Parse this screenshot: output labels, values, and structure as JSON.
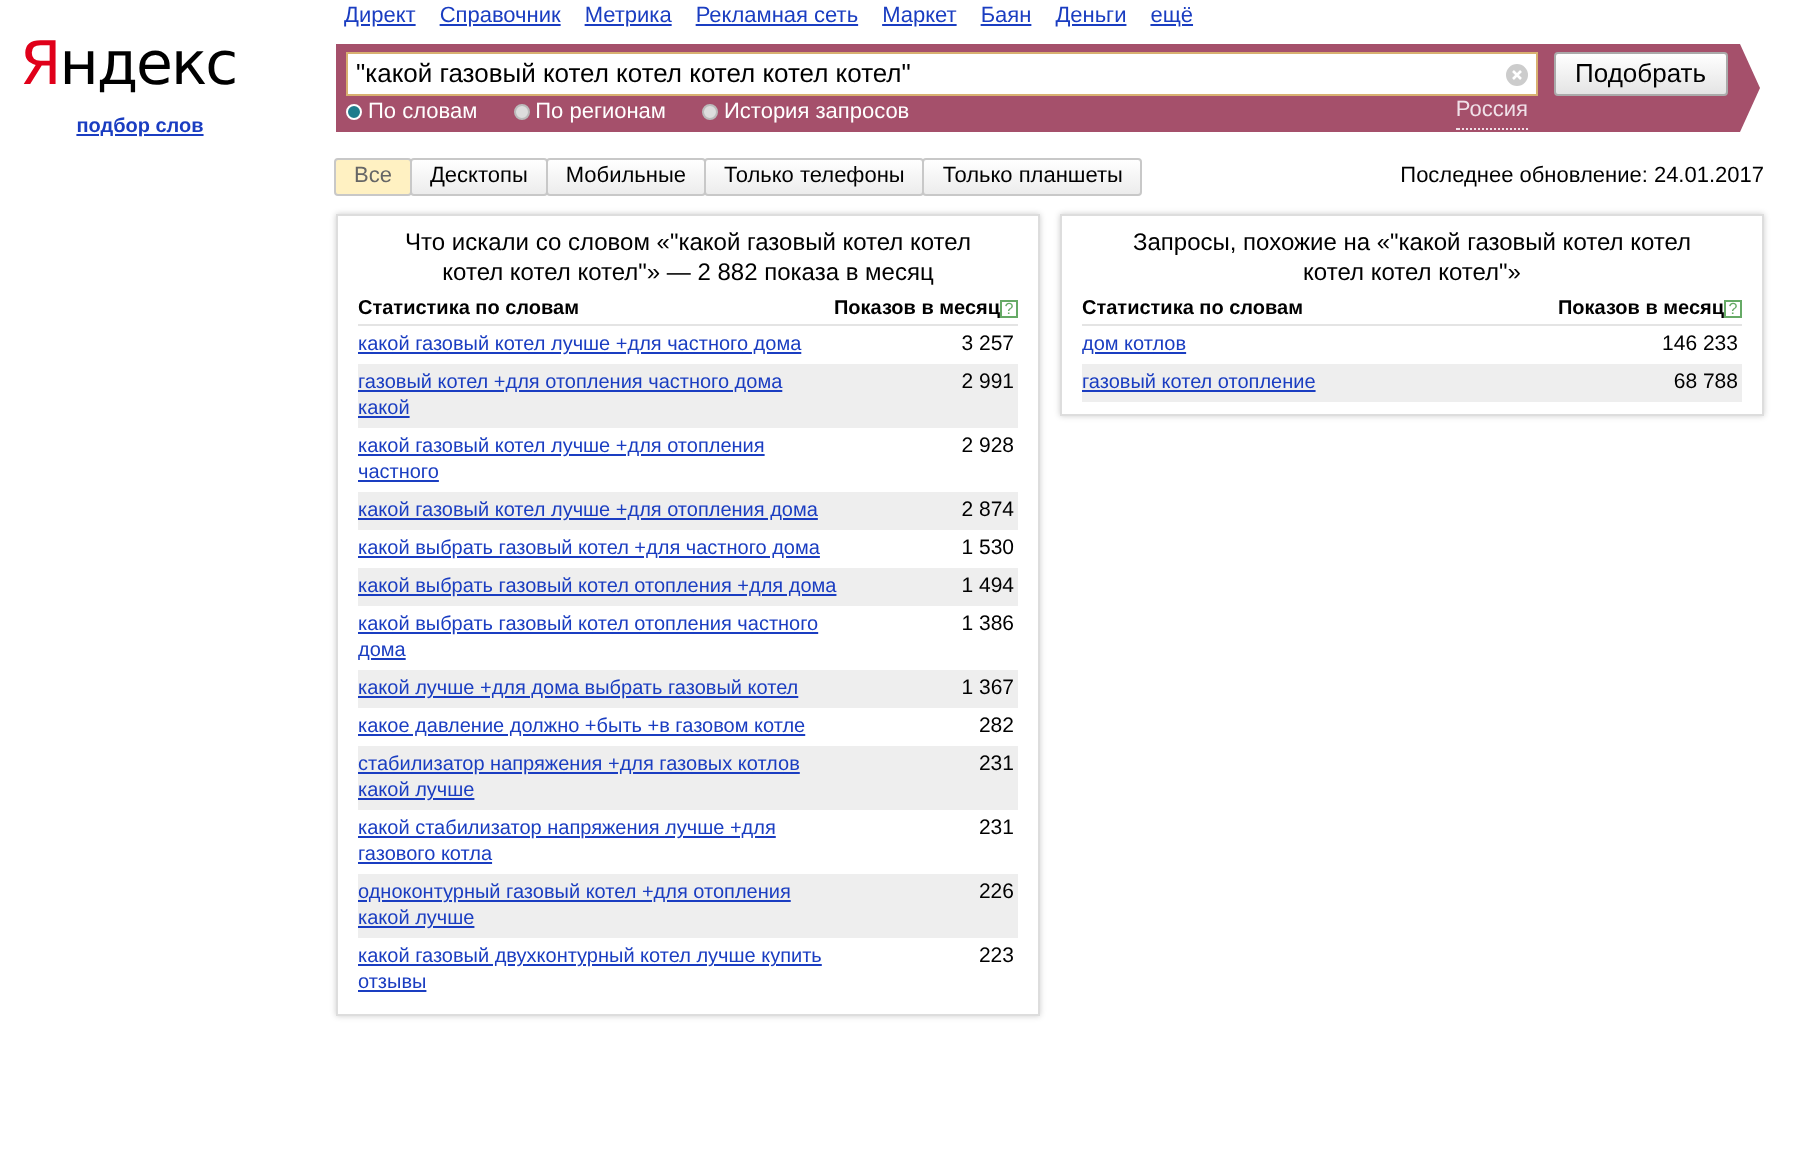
{
  "logo": {
    "text": "Яндекс",
    "subtitle": "подбор слов"
  },
  "services": [
    "Директ",
    "Справочник",
    "Метрика",
    "Рекламная сеть",
    "Маркет",
    "Баян",
    "Деньги",
    "ещё"
  ],
  "search": {
    "value": "\"какой газовый котел котел котел котел котел\"",
    "button": "Подобрать",
    "region": "Россия"
  },
  "modes": [
    {
      "label": "По словам",
      "selected": true
    },
    {
      "label": "По регионам",
      "selected": false
    },
    {
      "label": "История запросов",
      "selected": false
    }
  ],
  "tabs": [
    {
      "label": "Все",
      "selected": true
    },
    {
      "label": "Десктопы",
      "selected": false
    },
    {
      "label": "Мобильные",
      "selected": false
    },
    {
      "label": "Только телефоны",
      "selected": false
    },
    {
      "label": "Только планшеты",
      "selected": false
    }
  ],
  "last_update": "Последнее обновление: 24.01.2017",
  "panels": [
    {
      "title": "Что искали со словом «\"какой газовый котел котел котел котел котел\"» — 2 882 показа в месяц",
      "columns": [
        "Статистика по словам",
        "Показов в месяц"
      ],
      "help": "?",
      "rows": [
        {
          "phrase": "какой газовый котел лучше +для частного дома",
          "count": "3 257"
        },
        {
          "phrase": "газовый котел +для отопления частного дома какой",
          "count": "2 991"
        },
        {
          "phrase": "какой газовый котел лучше +для отопления частного",
          "count": "2 928"
        },
        {
          "phrase": "какой газовый котел лучше +для отопления дома",
          "count": "2 874"
        },
        {
          "phrase": "какой выбрать газовый котел +для частного дома",
          "count": "1 530"
        },
        {
          "phrase": "какой выбрать газовый котел отопления +для дома",
          "count": "1 494"
        },
        {
          "phrase": "какой выбрать газовый котел отопления частного дома",
          "count": "1 386"
        },
        {
          "phrase": "какой лучше +для дома выбрать газовый котел",
          "count": "1 367"
        },
        {
          "phrase": "какое давление должно +быть +в газовом котле",
          "count": "282"
        },
        {
          "phrase": "стабилизатор напряжения +для газовых котлов какой лучше",
          "count": "231"
        },
        {
          "phrase": "какой стабилизатор напряжения лучше +для газового котла",
          "count": "231"
        },
        {
          "phrase": "одноконтурный газовый котел +для отопления какой лучше",
          "count": "226"
        },
        {
          "phrase": "какой газовый двухконтурный котел лучше купить отзывы",
          "count": "223"
        }
      ]
    },
    {
      "title": "Запросы, похожие на «\"какой газовый котел котел котел котел котел\"»",
      "columns": [
        "Статистика по словам",
        "Показов в месяц"
      ],
      "help": "?",
      "rows": [
        {
          "phrase": "дом котлов",
          "count": "146 233"
        },
        {
          "phrase": "газовый котел отопление",
          "count": "68 788"
        }
      ]
    }
  ]
}
